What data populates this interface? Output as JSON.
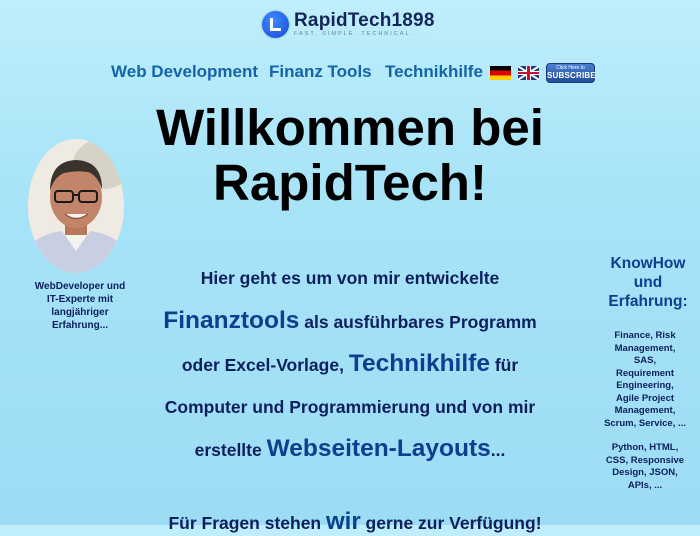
{
  "header": {
    "logo_title": "RapidTech1898",
    "logo_tagline": "FAST. SIMPLE. TECHNICAL. . ."
  },
  "nav": {
    "items": [
      {
        "label": "Web Development"
      },
      {
        "label": "Finanz Tools"
      },
      {
        "label": "Technikhilfe"
      }
    ],
    "flags": [
      "german-flag-icon",
      "uk-flag-icon"
    ],
    "subscribe": {
      "small": "Click Here to",
      "big": "SUBSCRIBE"
    }
  },
  "hero": {
    "title_line1": "Willkommen bei",
    "title_line2": "RapidTech!"
  },
  "left": {
    "caption": "WebDeveloper und IT-Experte mit langjähriger Erfahrung..."
  },
  "intro": {
    "t1": "Hier geht es um von mir entwickelte",
    "h1": "Finanztools",
    "t2": " als ausführbares Programm",
    "t3": "oder Excel-Vorlage, ",
    "h2": "Technikhilfe",
    "t4": " für",
    "t5": "Computer und Programmierung und von mir",
    "t6": "erstellte ",
    "h3": "Webseiten-Layouts",
    "t7": "..."
  },
  "contact": {
    "t1": "Für Fragen stehen ",
    "h1": "wir",
    "t2": " gerne zur Verfügung!"
  },
  "knowhow": {
    "title": "KnowHow und Erfahrung:",
    "block1": "Finance, Risk Management, SAS, Requirement Engineering, Agile Project Management, Scrum, Service, ...",
    "block2": "Python, HTML, CSS, Responsive Design, JSON, APIs, ..."
  },
  "colors": {
    "background": "#a8e4f8",
    "nav_link": "#1464a8",
    "text": "#0d1f5c",
    "highlight": "#0d3f8f"
  }
}
